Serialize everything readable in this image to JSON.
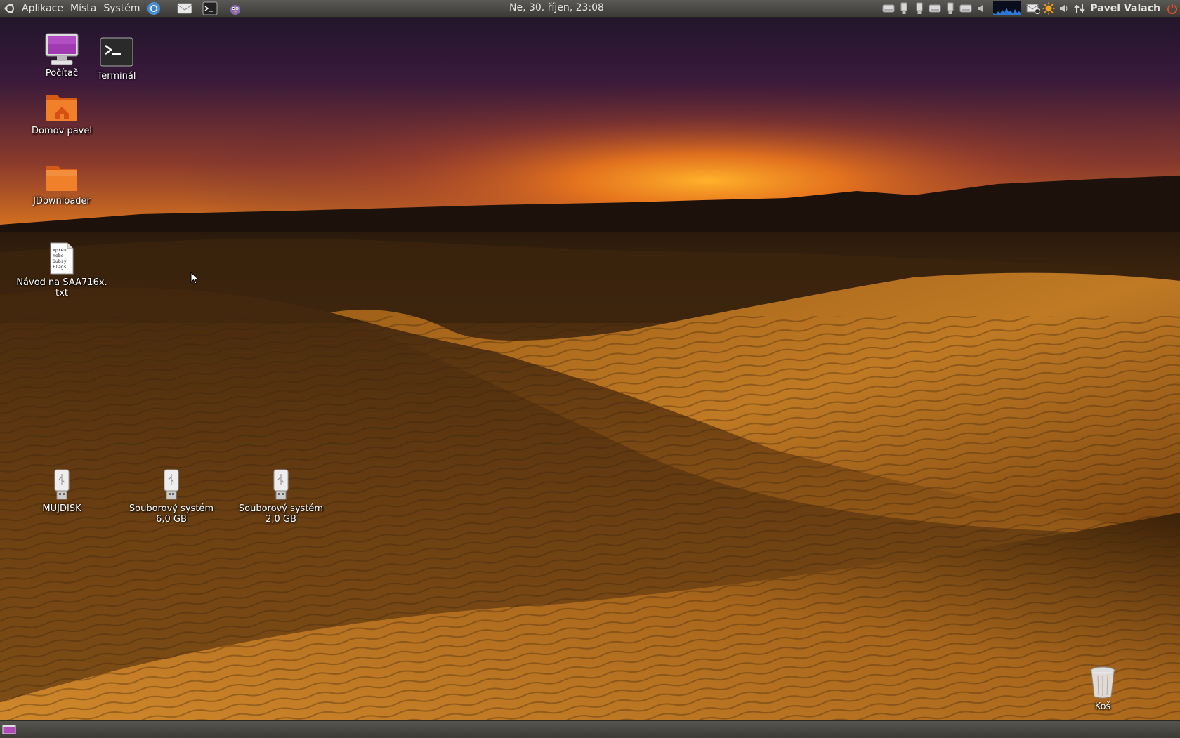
{
  "top_panel": {
    "menus": [
      {
        "label": "Aplikace"
      },
      {
        "label": "Místa"
      },
      {
        "label": "Systém"
      }
    ],
    "launchers": [
      "chromium-icon",
      "mail-icon",
      "terminal-icon",
      "pidgin-icon"
    ],
    "clock": "Ne, 30. říjen, 23:08",
    "user": "Pavel Valach"
  },
  "desktop": {
    "icons": [
      {
        "label": "Počítač",
        "icon": "computer-icon"
      },
      {
        "label": "Terminál",
        "icon": "terminal-icon"
      },
      {
        "label": "Domov pavel",
        "icon": "home-folder-icon"
      },
      {
        "label": "JDownloader",
        "icon": "folder-icon"
      },
      {
        "label": "Návod na SAA716x.\ntxt",
        "icon": "text-file-icon",
        "preview": "<pre>\nnebo\nSubsy\nFlags"
      },
      {
        "label": "MUJDISK",
        "icon": "usb-drive-icon"
      },
      {
        "label": "Souborový systém\n6,0 GB",
        "icon": "usb-drive-icon"
      },
      {
        "label": "Souborový systém\n2,0 GB",
        "icon": "usb-drive-icon"
      },
      {
        "label": "Koš",
        "icon": "trash-icon"
      }
    ]
  },
  "colors": {
    "panel": "#3c3b37",
    "sky_top": "#1c1428",
    "sunset": "#f59a1a",
    "sand": "#b86f1a"
  }
}
